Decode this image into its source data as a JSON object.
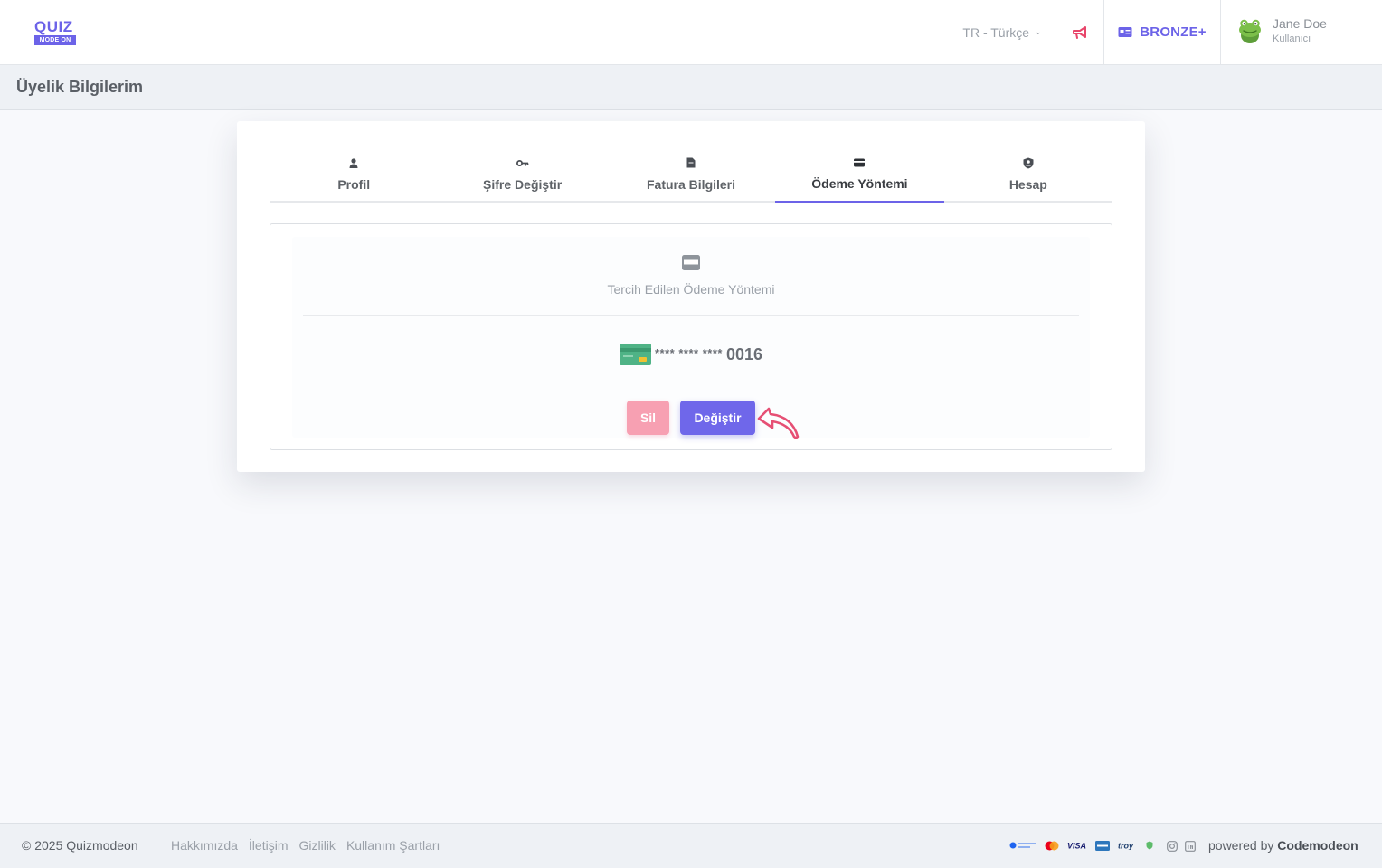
{
  "header": {
    "logo_top": "QUIZ",
    "logo_bottom": "MODE ON",
    "language": "TR - Türkçe",
    "plan": "BRONZE+",
    "user_name": "Jane Doe",
    "user_role": "Kullanıcı"
  },
  "page": {
    "title": "Üyelik Bilgilerim"
  },
  "tabs": [
    {
      "label": "Profil",
      "icon": "user-icon"
    },
    {
      "label": "Şifre Değiştir",
      "icon": "key-icon"
    },
    {
      "label": "Fatura Bilgileri",
      "icon": "document-icon"
    },
    {
      "label": "Ödeme Yöntemi",
      "icon": "credit-card-icon",
      "active": true
    },
    {
      "label": "Hesap",
      "icon": "user-shield-icon"
    }
  ],
  "payment": {
    "title": "Tercih Edilen Ödeme Yöntemi",
    "masked": "**** **** ****",
    "last4": "0016",
    "delete_label": "Sil",
    "change_label": "Değiştir"
  },
  "footer": {
    "copyright": "© 2025 Quizmodeon",
    "links": [
      "Hakkımızda",
      "İletişim",
      "Gizlilik",
      "Kullanım Şartları"
    ],
    "powered_prefix": "powered by",
    "powered_brand": "Codemodeon"
  },
  "colors": {
    "accent": "#6c63e8",
    "danger": "#f7a0b2",
    "announce": "#e8456a"
  }
}
